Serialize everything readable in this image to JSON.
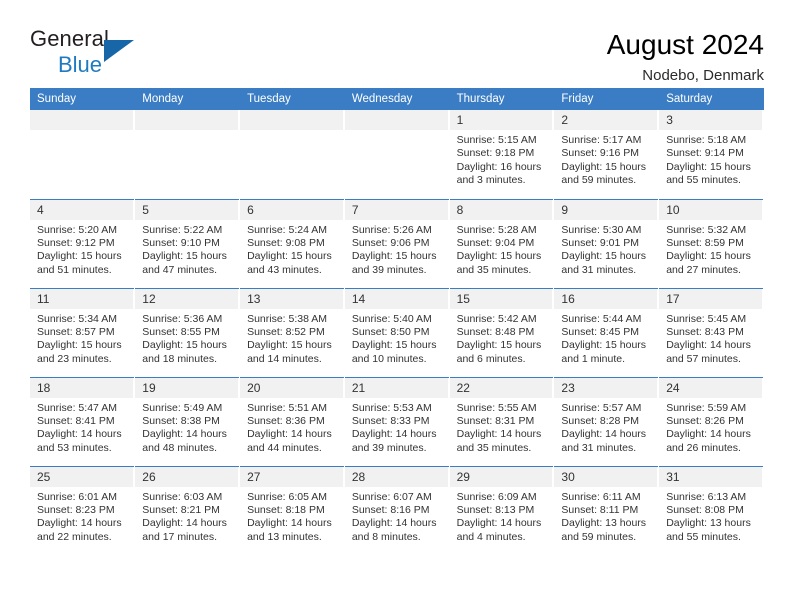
{
  "brand": {
    "name_top": "General",
    "name_bottom": "Blue",
    "triangle_color": "#1766a8",
    "blue": "#1f7bc1"
  },
  "header": {
    "title": "August 2024",
    "subtitle": "Nodebo, Denmark",
    "accent_color": "#3b7dc4",
    "daynum_background": "#f1f1f1"
  },
  "weekdays": [
    "Sunday",
    "Monday",
    "Tuesday",
    "Wednesday",
    "Thursday",
    "Friday",
    "Saturday"
  ],
  "labels": {
    "sunrise": "Sunrise:",
    "sunset": "Sunset:",
    "daylight": "Daylight:"
  },
  "weeks": [
    [
      {
        "day": "",
        "blank": true
      },
      {
        "day": "",
        "blank": true
      },
      {
        "day": "",
        "blank": true
      },
      {
        "day": "",
        "blank": true
      },
      {
        "day": "1",
        "sunrise": "Sunrise: 5:15 AM",
        "sunset": "Sunset: 9:18 PM",
        "daylight1": "Daylight: 16 hours",
        "daylight2": "and 3 minutes."
      },
      {
        "day": "2",
        "sunrise": "Sunrise: 5:17 AM",
        "sunset": "Sunset: 9:16 PM",
        "daylight1": "Daylight: 15 hours",
        "daylight2": "and 59 minutes."
      },
      {
        "day": "3",
        "sunrise": "Sunrise: 5:18 AM",
        "sunset": "Sunset: 9:14 PM",
        "daylight1": "Daylight: 15 hours",
        "daylight2": "and 55 minutes."
      }
    ],
    [
      {
        "day": "4",
        "sunrise": "Sunrise: 5:20 AM",
        "sunset": "Sunset: 9:12 PM",
        "daylight1": "Daylight: 15 hours",
        "daylight2": "and 51 minutes."
      },
      {
        "day": "5",
        "sunrise": "Sunrise: 5:22 AM",
        "sunset": "Sunset: 9:10 PM",
        "daylight1": "Daylight: 15 hours",
        "daylight2": "and 47 minutes."
      },
      {
        "day": "6",
        "sunrise": "Sunrise: 5:24 AM",
        "sunset": "Sunset: 9:08 PM",
        "daylight1": "Daylight: 15 hours",
        "daylight2": "and 43 minutes."
      },
      {
        "day": "7",
        "sunrise": "Sunrise: 5:26 AM",
        "sunset": "Sunset: 9:06 PM",
        "daylight1": "Daylight: 15 hours",
        "daylight2": "and 39 minutes."
      },
      {
        "day": "8",
        "sunrise": "Sunrise: 5:28 AM",
        "sunset": "Sunset: 9:04 PM",
        "daylight1": "Daylight: 15 hours",
        "daylight2": "and 35 minutes."
      },
      {
        "day": "9",
        "sunrise": "Sunrise: 5:30 AM",
        "sunset": "Sunset: 9:01 PM",
        "daylight1": "Daylight: 15 hours",
        "daylight2": "and 31 minutes."
      },
      {
        "day": "10",
        "sunrise": "Sunrise: 5:32 AM",
        "sunset": "Sunset: 8:59 PM",
        "daylight1": "Daylight: 15 hours",
        "daylight2": "and 27 minutes."
      }
    ],
    [
      {
        "day": "11",
        "sunrise": "Sunrise: 5:34 AM",
        "sunset": "Sunset: 8:57 PM",
        "daylight1": "Daylight: 15 hours",
        "daylight2": "and 23 minutes."
      },
      {
        "day": "12",
        "sunrise": "Sunrise: 5:36 AM",
        "sunset": "Sunset: 8:55 PM",
        "daylight1": "Daylight: 15 hours",
        "daylight2": "and 18 minutes."
      },
      {
        "day": "13",
        "sunrise": "Sunrise: 5:38 AM",
        "sunset": "Sunset: 8:52 PM",
        "daylight1": "Daylight: 15 hours",
        "daylight2": "and 14 minutes."
      },
      {
        "day": "14",
        "sunrise": "Sunrise: 5:40 AM",
        "sunset": "Sunset: 8:50 PM",
        "daylight1": "Daylight: 15 hours",
        "daylight2": "and 10 minutes."
      },
      {
        "day": "15",
        "sunrise": "Sunrise: 5:42 AM",
        "sunset": "Sunset: 8:48 PM",
        "daylight1": "Daylight: 15 hours",
        "daylight2": "and 6 minutes."
      },
      {
        "day": "16",
        "sunrise": "Sunrise: 5:44 AM",
        "sunset": "Sunset: 8:45 PM",
        "daylight1": "Daylight: 15 hours",
        "daylight2": "and 1 minute."
      },
      {
        "day": "17",
        "sunrise": "Sunrise: 5:45 AM",
        "sunset": "Sunset: 8:43 PM",
        "daylight1": "Daylight: 14 hours",
        "daylight2": "and 57 minutes."
      }
    ],
    [
      {
        "day": "18",
        "sunrise": "Sunrise: 5:47 AM",
        "sunset": "Sunset: 8:41 PM",
        "daylight1": "Daylight: 14 hours",
        "daylight2": "and 53 minutes."
      },
      {
        "day": "19",
        "sunrise": "Sunrise: 5:49 AM",
        "sunset": "Sunset: 8:38 PM",
        "daylight1": "Daylight: 14 hours",
        "daylight2": "and 48 minutes."
      },
      {
        "day": "20",
        "sunrise": "Sunrise: 5:51 AM",
        "sunset": "Sunset: 8:36 PM",
        "daylight1": "Daylight: 14 hours",
        "daylight2": "and 44 minutes."
      },
      {
        "day": "21",
        "sunrise": "Sunrise: 5:53 AM",
        "sunset": "Sunset: 8:33 PM",
        "daylight1": "Daylight: 14 hours",
        "daylight2": "and 39 minutes."
      },
      {
        "day": "22",
        "sunrise": "Sunrise: 5:55 AM",
        "sunset": "Sunset: 8:31 PM",
        "daylight1": "Daylight: 14 hours",
        "daylight2": "and 35 minutes."
      },
      {
        "day": "23",
        "sunrise": "Sunrise: 5:57 AM",
        "sunset": "Sunset: 8:28 PM",
        "daylight1": "Daylight: 14 hours",
        "daylight2": "and 31 minutes."
      },
      {
        "day": "24",
        "sunrise": "Sunrise: 5:59 AM",
        "sunset": "Sunset: 8:26 PM",
        "daylight1": "Daylight: 14 hours",
        "daylight2": "and 26 minutes."
      }
    ],
    [
      {
        "day": "25",
        "sunrise": "Sunrise: 6:01 AM",
        "sunset": "Sunset: 8:23 PM",
        "daylight1": "Daylight: 14 hours",
        "daylight2": "and 22 minutes."
      },
      {
        "day": "26",
        "sunrise": "Sunrise: 6:03 AM",
        "sunset": "Sunset: 8:21 PM",
        "daylight1": "Daylight: 14 hours",
        "daylight2": "and 17 minutes."
      },
      {
        "day": "27",
        "sunrise": "Sunrise: 6:05 AM",
        "sunset": "Sunset: 8:18 PM",
        "daylight1": "Daylight: 14 hours",
        "daylight2": "and 13 minutes."
      },
      {
        "day": "28",
        "sunrise": "Sunrise: 6:07 AM",
        "sunset": "Sunset: 8:16 PM",
        "daylight1": "Daylight: 14 hours",
        "daylight2": "and 8 minutes."
      },
      {
        "day": "29",
        "sunrise": "Sunrise: 6:09 AM",
        "sunset": "Sunset: 8:13 PM",
        "daylight1": "Daylight: 14 hours",
        "daylight2": "and 4 minutes."
      },
      {
        "day": "30",
        "sunrise": "Sunrise: 6:11 AM",
        "sunset": "Sunset: 8:11 PM",
        "daylight1": "Daylight: 13 hours",
        "daylight2": "and 59 minutes."
      },
      {
        "day": "31",
        "sunrise": "Sunrise: 6:13 AM",
        "sunset": "Sunset: 8:08 PM",
        "daylight1": "Daylight: 13 hours",
        "daylight2": "and 55 minutes."
      }
    ]
  ]
}
